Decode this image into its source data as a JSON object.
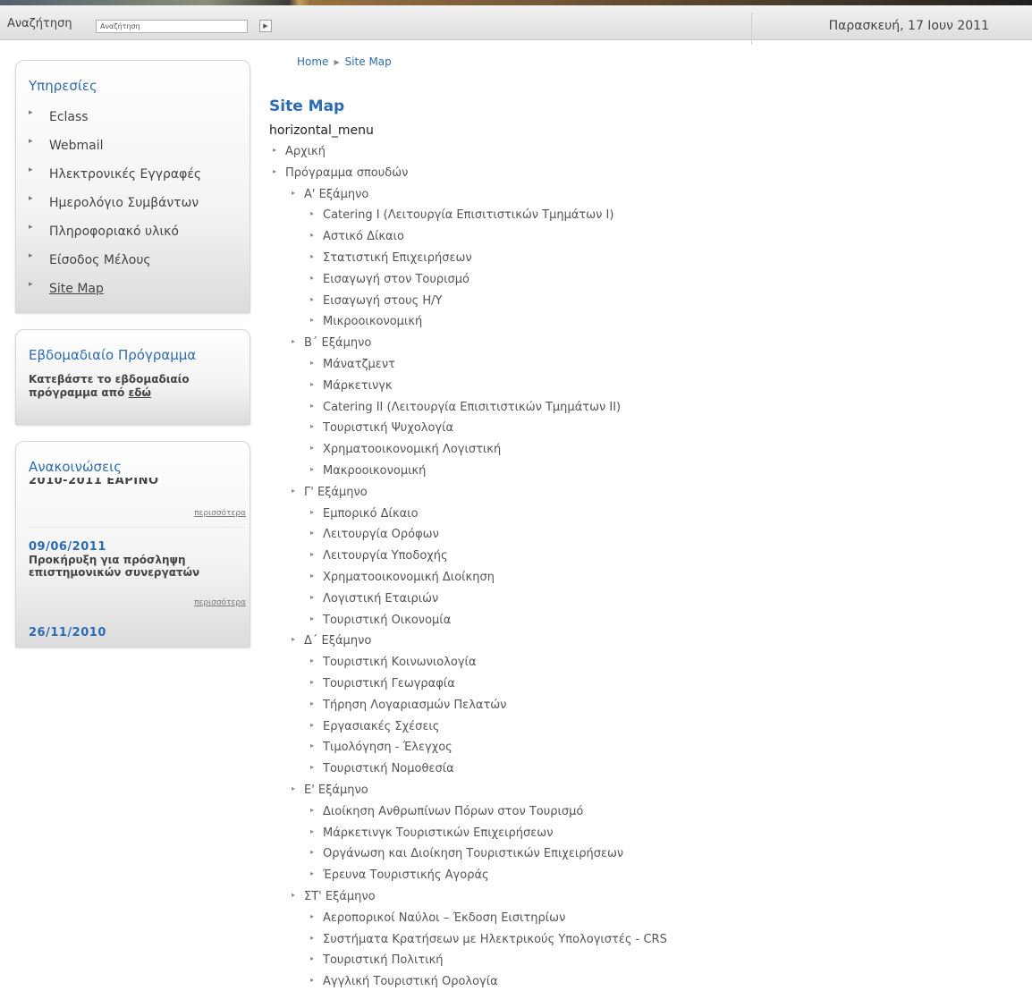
{
  "header": {
    "search_label": "Αναζήτηση",
    "search_placeholder": "Αναζήτηση",
    "search_go_icon": "play-arrow-icon",
    "date": "Παρασκευή, 17 Ιουν 2011"
  },
  "sidebar": {
    "services": {
      "title": "Υπηρεσίες",
      "items": [
        {
          "label": "Eclass"
        },
        {
          "label": "Webmail"
        },
        {
          "label": "Ηλεκτρονικές Εγγραφές"
        },
        {
          "label": "Ημερολόγιο Συμβάντων"
        },
        {
          "label": "Πληροφοριακό υλικό"
        },
        {
          "label": "Είσοδος Μέλους"
        },
        {
          "label": "Site Map"
        }
      ]
    },
    "weekly": {
      "title": "Εβδομαδιαίο Πρόγραμμα",
      "text": "Κατεβάστε το εβδομαδιαίο πρόγραμμα από",
      "link": "εδώ"
    },
    "announcements": {
      "title": "Ανακοινώσεις",
      "items": [
        {
          "date": "",
          "text": "2010-2011 ΕΑΡΙΝΟ",
          "more": "περισσότερα"
        },
        {
          "date": "09/06/2011",
          "text": "Προκήρυξη για πρόσληψη επιστημονικών συνεργατών",
          "more": "περισσότερα"
        },
        {
          "date": "26/11/2010",
          "text": "",
          "more": ""
        }
      ]
    }
  },
  "breadcrumb": {
    "home": "Home",
    "current": "Site Map"
  },
  "main": {
    "title": "Site Map",
    "menu_name": "horizontal_menu",
    "tree": [
      {
        "level": 0,
        "label": "Αρχική"
      },
      {
        "level": 0,
        "label": "Πρόγραμμα σπουδών"
      },
      {
        "level": 1,
        "label": "Α' Εξάμηνο"
      },
      {
        "level": 2,
        "label": "Catering I (Λειτουργία Επισιτιστικών Τμημάτων I)"
      },
      {
        "level": 2,
        "label": "Αστικό Δίκαιο"
      },
      {
        "level": 2,
        "label": "Στατιστική Επιχειρήσεων"
      },
      {
        "level": 2,
        "label": "Εισαγωγή στον Τουρισμό"
      },
      {
        "level": 2,
        "label": "Εισαγωγή στους Η/Υ"
      },
      {
        "level": 2,
        "label": "Μικροοικονομική"
      },
      {
        "level": 1,
        "label": "Β΄ Εξάμηνο"
      },
      {
        "level": 2,
        "label": "Μάνατζμεντ"
      },
      {
        "level": 2,
        "label": "Μάρκετινγκ"
      },
      {
        "level": 2,
        "label": "Catering II (Λειτουργία Επισιτιστικών Τμημάτων II)"
      },
      {
        "level": 2,
        "label": "Τουριστική Ψυχολογία"
      },
      {
        "level": 2,
        "label": "Χρηματοοικονομική Λογιστική"
      },
      {
        "level": 2,
        "label": "Μακροοικονομική"
      },
      {
        "level": 1,
        "label": "Γ' Εξάμηνο"
      },
      {
        "level": 2,
        "label": "Εμπορικό Δίκαιο"
      },
      {
        "level": 2,
        "label": "Λειτουργία Ορόφων"
      },
      {
        "level": 2,
        "label": "Λειτουργία Υποδοχής"
      },
      {
        "level": 2,
        "label": "Χρηματοοικονομική Διοίκηση"
      },
      {
        "level": 2,
        "label": "Λογιστική Εταιριών"
      },
      {
        "level": 2,
        "label": "Τουριστική Οικονομία"
      },
      {
        "level": 1,
        "label": "Δ΄ Εξάμηνο"
      },
      {
        "level": 2,
        "label": "Τουριστική Κοινωνιολογία"
      },
      {
        "level": 2,
        "label": "Τουριστική Γεωγραφία"
      },
      {
        "level": 2,
        "label": "Τήρηση Λογαριασμών Πελατών"
      },
      {
        "level": 2,
        "label": "Εργασιακές Σχέσεις"
      },
      {
        "level": 2,
        "label": "Τιμολόγηση - Έλεγχος"
      },
      {
        "level": 2,
        "label": "Τουριστική Νομοθεσία"
      },
      {
        "level": 1,
        "label": "Ε' Εξάμηνο"
      },
      {
        "level": 2,
        "label": "Διοίκηση Ανθρωπίνων Πόρων στον Τουρισμό"
      },
      {
        "level": 2,
        "label": "Μάρκετινγκ Τουριστικών Επιχειρήσεων"
      },
      {
        "level": 2,
        "label": "Οργάνωση και Διοίκηση Τουριστικών Επιχειρήσεων"
      },
      {
        "level": 2,
        "label": "Έρευνα Τουριστικής Αγοράς"
      },
      {
        "level": 1,
        "label": "ΣΤ' Εξάμηνο"
      },
      {
        "level": 2,
        "label": "Αεροπορικοί Ναύλοι – Έκδοση Εισιτηρίων"
      },
      {
        "level": 2,
        "label": "Συστήματα Κρατήσεων με Ηλεκτρικούς Υπολογιστές - CRS"
      },
      {
        "level": 2,
        "label": "Τουριστική Πολιτική"
      },
      {
        "level": 2,
        "label": "Αγγλική Τουριστική Ορολογία"
      }
    ]
  }
}
